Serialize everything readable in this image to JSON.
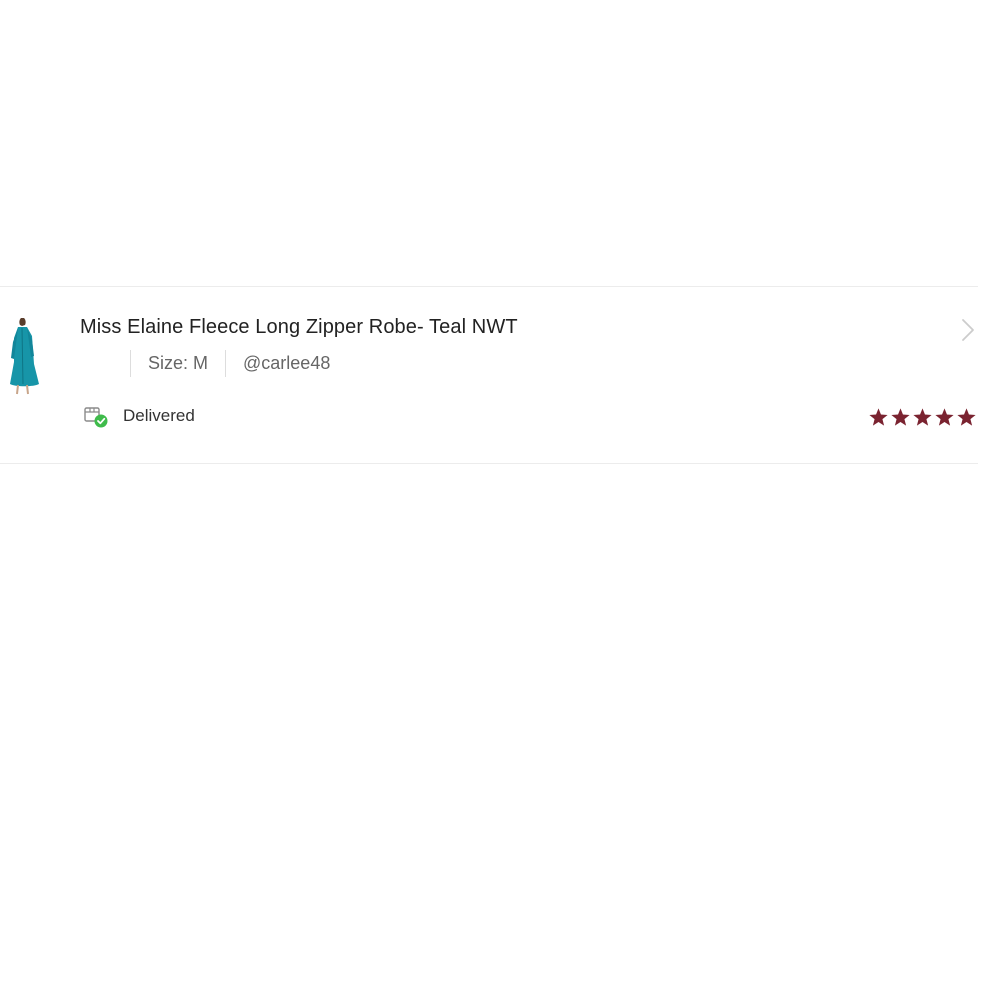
{
  "order": {
    "title": "Miss Elaine Fleece Long Zipper Robe- Teal NWT",
    "size": "Size: M",
    "seller": "@carlee48",
    "status": "Delivered",
    "rating": 5,
    "rating_max": 5
  },
  "icons": {
    "thumbnail": "robe-product-image",
    "status": "delivered-box-check-icon",
    "star": "star-icon",
    "chevron": "chevron-right-icon"
  },
  "colors": {
    "star": "#7a2330",
    "check": "#3fbb4b",
    "robe": "#1795a8"
  }
}
